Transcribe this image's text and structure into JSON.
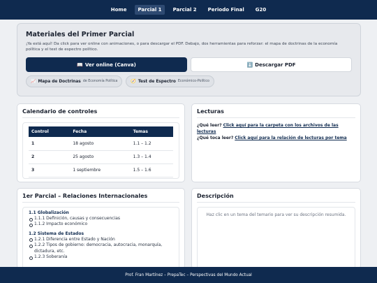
{
  "nav": {
    "items": [
      {
        "label": "Home",
        "active": false
      },
      {
        "label": "Parcial 1",
        "active": true
      },
      {
        "label": "Parcial 2",
        "active": false
      },
      {
        "label": "Periodo Final",
        "active": false
      },
      {
        "label": "G20",
        "active": false
      }
    ]
  },
  "hero": {
    "title": "Materiales del Primer Parcial",
    "description": "¡Ya está aquí! Da click para ver online con animaciones, o para descargar el PDF. Debajo, dos herramientas para reforzar: el mapa de doctrinas de la economía política y el test de espectro político.",
    "view_button": "Ver online (Canva)",
    "view_icon": "📖",
    "download_button": "Descargar PDF",
    "download_icon": "⬇️",
    "chips": [
      {
        "label": "Mapa de Doctrinas",
        "sub": "de Economía Política",
        "icon": "📈"
      },
      {
        "label": "Test de Espectro",
        "sub": "Económico-Político",
        "icon": "🧭"
      }
    ]
  },
  "calendar": {
    "title": "Calendario de controles",
    "headers": [
      "Control",
      "Fecha",
      "Temas"
    ],
    "rows": [
      [
        "1",
        "18 agosto",
        "1.1 – 1.2"
      ],
      [
        "2",
        "25 agosto",
        "1.3 – 1.4"
      ],
      [
        "3",
        "1 septiembre",
        "1.5 – 1.6"
      ]
    ]
  },
  "lecturas": {
    "title": "Lecturas",
    "q1": "¿Qué leer?",
    "link1": "Click aquí para la carpeta con los archivos de las lecturas",
    "q2": "¿Qué toca leer?",
    "link2": "Click aquí para la relación de lecturas por tema"
  },
  "parcial": {
    "title": "1er Parcial – Relaciones Internacionales",
    "sections": [
      {
        "title": "1.1 Globalización",
        "items": [
          "1.1.1 Definición, causas y consecuencias",
          "1.1.2 Impacto económico"
        ]
      },
      {
        "title": "1.2 Sistema de Estados",
        "items": [
          "1.2.1 Diferencia entre Estado y Nación",
          "1.2.2 Tipos de gobierno: democracia, autocracia, monarquía, dictadura, etc.",
          "1.2.3 Soberanía"
        ]
      }
    ]
  },
  "descripcion": {
    "title": "Descripción",
    "placeholder": "Haz clic en un tema del temario para ver su descripción resumida."
  },
  "footer": {
    "text": "Prof. Fran Martínez – PrepaTec – Perspectivas del Mundo Actual"
  }
}
